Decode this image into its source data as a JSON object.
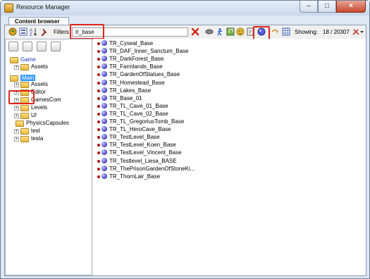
{
  "window": {
    "title": "Resource Manager",
    "close_label": "×",
    "minimize_label": "–",
    "maximize_label": "□"
  },
  "tabs": [
    "Content browser"
  ],
  "toolbar": {
    "filters_label": "Filters",
    "filter_value": "tr_base",
    "showing_label": "Showing:",
    "showing_value": "18 / 20307"
  },
  "tree": [
    {
      "label": "Game",
      "expander": "",
      "color": "#1a3fbf",
      "indent": 0
    },
    {
      "label": "Assets",
      "expander": "+",
      "color": "#000000",
      "indent": 1
    },
    {
      "label": "Main",
      "expander": "",
      "color": "#1a3fbf",
      "indent": 0,
      "selected": true
    },
    {
      "label": "Assets",
      "expander": "+",
      "color": "#000000",
      "indent": 1
    },
    {
      "label": "Editor",
      "expander": "+",
      "color": "#000000",
      "indent": 1
    },
    {
      "label": "GamesCom",
      "expander": "+",
      "color": "#000000",
      "indent": 1
    },
    {
      "label": "Levels",
      "expander": "+",
      "color": "#000000",
      "indent": 1
    },
    {
      "label": "UI",
      "expander": "+",
      "color": "#000000",
      "indent": 1
    },
    {
      "label": "PhysicsCapsules",
      "expander": "",
      "color": "#000000",
      "indent": 1
    },
    {
      "label": "test",
      "expander": "+",
      "color": "#000000",
      "indent": 1
    },
    {
      "label": "testa",
      "expander": "+",
      "color": "#000000",
      "indent": 1
    }
  ],
  "results": [
    "TR_Cyseal_Base",
    "TR_DAF_Inner_Sanctum_Base",
    "TR_DarkForest_Base",
    "TR_Farmlands_Base",
    "TR_GardenOfStatues_Base",
    "TR_Homestead_Base",
    "TR_Lakes_Base",
    "TR_Base_01",
    "TR_TL_Cave_01_Base",
    "TR_TL_Cave_02_Base",
    "TR_TL_GregoriusTomb_Base",
    "TR_TL_HeroCave_Base",
    "TR_TestLevel_Base",
    "TR_TestLevel_Koen_Base",
    "TR_TestLevel_Vincent_Base",
    "TR_Testlevel_Liesa_BASE",
    "TR_ThePrisonGardenOfStoneKi...",
    "TR_ThornLair_Base"
  ],
  "colors": {
    "highlight": "#e0241b",
    "selection": "#3399ff",
    "link_blue": "#1a3fbf"
  }
}
